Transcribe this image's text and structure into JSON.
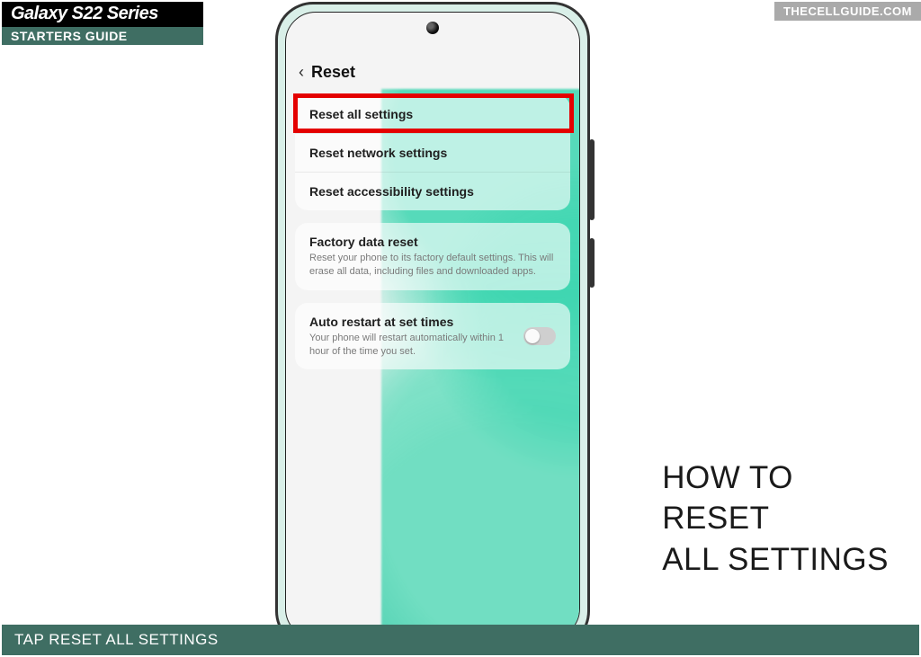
{
  "banner": {
    "title": "Galaxy S22 Series",
    "subtitle": "STARTERS GUIDE"
  },
  "watermark": "THECELLGUIDE.COM",
  "caption": "TAP RESET ALL SETTINGS",
  "screen": {
    "page_title": "Reset",
    "rows": {
      "reset_all": "Reset all settings",
      "reset_network": "Reset network settings",
      "reset_accessibility": "Reset accessibility settings",
      "factory_title": "Factory data reset",
      "factory_desc": "Reset your phone to its factory default settings. This will erase all data, including files and downloaded apps.",
      "auto_restart_title": "Auto restart at set times",
      "auto_restart_desc": "Your phone will restart automatically within 1 hour of the time you set."
    }
  },
  "overlay": {
    "line1": "HOW TO",
    "line2": "RESET",
    "line3": "ALL SETTINGS"
  }
}
